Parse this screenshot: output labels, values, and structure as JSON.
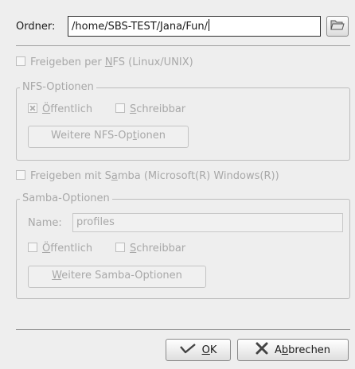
{
  "folder": {
    "label": "Ordner:",
    "value": "/home/SBS-TEST/Jana/Fun/",
    "browse_icon": "folder-open-icon"
  },
  "nfs": {
    "share_checkbox": {
      "label_pre": "Freigeben per ",
      "label_ul": "N",
      "label_post": "FS (Linux/UNIX)",
      "checked": false
    },
    "group_title": "NFS-Optionen",
    "public": {
      "label_pre": "",
      "label_ul": "Ö",
      "label_post": "ffentlich",
      "checked": true
    },
    "writable": {
      "label_pre": "",
      "label_ul": "S",
      "label_post": "chreibbar",
      "checked": false
    },
    "more_button": {
      "label_pre": "Weitere NFS-Op",
      "label_ul": "t",
      "label_post": "ionen"
    }
  },
  "samba": {
    "share_checkbox": {
      "label_pre": "Freigeben mit S",
      "label_ul": "a",
      "label_post": "mba (Microsoft(R) Windows(R))",
      "checked": false
    },
    "group_title": "Samba-Optionen",
    "name_label": "Name:",
    "name_value": "profiles",
    "public": {
      "label_pre": "",
      "label_ul": "Ö",
      "label_post": "ffentlich",
      "checked": false
    },
    "writable": {
      "label_pre": "",
      "label_ul": "S",
      "label_post": "chreibbar",
      "checked": false
    },
    "more_button": {
      "label_pre": "",
      "label_ul": "W",
      "label_post": "eitere Samba-Optionen"
    }
  },
  "footer": {
    "ok": {
      "label_ul": "O",
      "label_post": "K",
      "icon": "checkmark-icon"
    },
    "cancel": {
      "label_pre": "A",
      "label_ul": "b",
      "label_post": "brechen",
      "icon": "cancel-x-icon"
    }
  }
}
